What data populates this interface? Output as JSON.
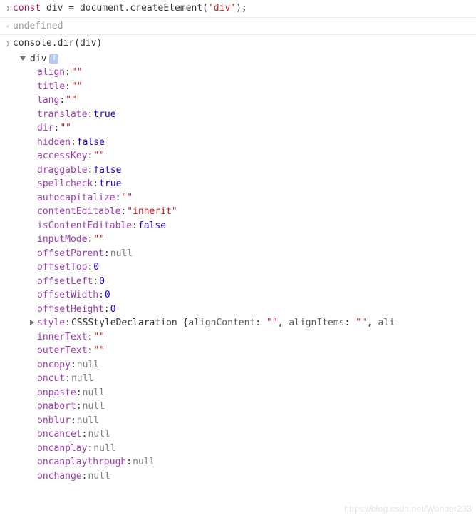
{
  "line1": {
    "kw": "const",
    "var": "div",
    "obj": "document",
    "method": "createElement",
    "arg": "'div'"
  },
  "line2": {
    "text": "undefined"
  },
  "line3": {
    "obj": "console",
    "method": "dir",
    "arg": "div"
  },
  "dir": {
    "name": "div",
    "info": "i",
    "style_label": "style",
    "style_type": "CSSStyleDeclaration",
    "style_preview": {
      "k1": "alignContent",
      "v1": "\"\"",
      "k2": "alignItems",
      "v2": "\"\"",
      "k3": "ali"
    },
    "props": [
      {
        "key": "align",
        "type": "str",
        "val": "\"\""
      },
      {
        "key": "title",
        "type": "str",
        "val": "\"\""
      },
      {
        "key": "lang",
        "type": "str",
        "val": "\"\""
      },
      {
        "key": "translate",
        "type": "kw",
        "val": "true"
      },
      {
        "key": "dir",
        "type": "str",
        "val": "\"\""
      },
      {
        "key": "hidden",
        "type": "kw",
        "val": "false"
      },
      {
        "key": "accessKey",
        "type": "str",
        "val": "\"\""
      },
      {
        "key": "draggable",
        "type": "kw",
        "val": "false"
      },
      {
        "key": "spellcheck",
        "type": "kw",
        "val": "true"
      },
      {
        "key": "autocapitalize",
        "type": "str",
        "val": "\"\""
      },
      {
        "key": "contentEditable",
        "type": "str",
        "val": "\"inherit\""
      },
      {
        "key": "isContentEditable",
        "type": "kw",
        "val": "false"
      },
      {
        "key": "inputMode",
        "type": "str",
        "val": "\"\""
      },
      {
        "key": "offsetParent",
        "type": "null",
        "val": "null"
      },
      {
        "key": "offsetTop",
        "type": "num",
        "val": "0"
      },
      {
        "key": "offsetLeft",
        "type": "num",
        "val": "0"
      },
      {
        "key": "offsetWidth",
        "type": "num",
        "val": "0"
      },
      {
        "key": "offsetHeight",
        "type": "num",
        "val": "0"
      }
    ],
    "props2": [
      {
        "key": "innerText",
        "type": "str",
        "val": "\"\""
      },
      {
        "key": "outerText",
        "type": "str",
        "val": "\"\""
      },
      {
        "key": "oncopy",
        "type": "null",
        "val": "null"
      },
      {
        "key": "oncut",
        "type": "null",
        "val": "null"
      },
      {
        "key": "onpaste",
        "type": "null",
        "val": "null"
      },
      {
        "key": "onabort",
        "type": "null",
        "val": "null"
      },
      {
        "key": "onblur",
        "type": "null",
        "val": "null"
      },
      {
        "key": "oncancel",
        "type": "null",
        "val": "null"
      },
      {
        "key": "oncanplay",
        "type": "null",
        "val": "null"
      },
      {
        "key": "oncanplaythrough",
        "type": "null",
        "val": "null"
      },
      {
        "key": "onchange",
        "type": "null",
        "val": "null"
      }
    ]
  },
  "watermark": "https://blog.csdn.net/Wonder233"
}
